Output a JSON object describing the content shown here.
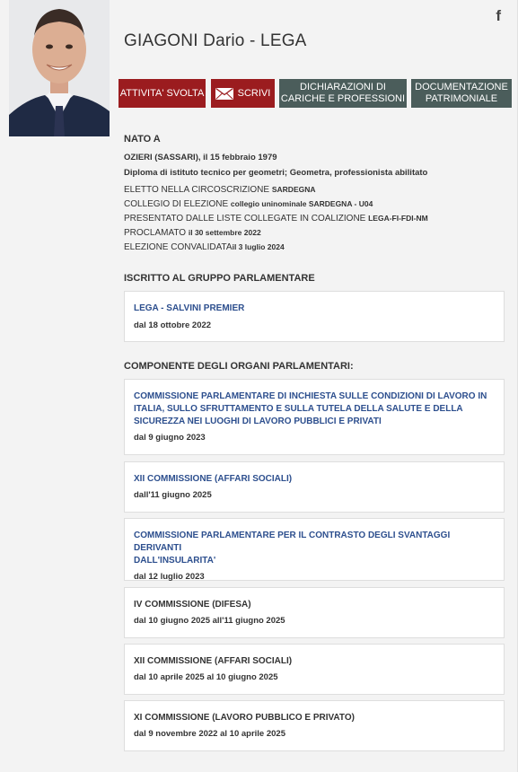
{
  "deputy": {
    "name": "GIAGONI Dario - LEGA",
    "facebook_label": "f"
  },
  "buttons": {
    "attivita": "ATTIVITA' SVOLTA",
    "scrivi": "SCRIVI",
    "dichiarazioni": [
      "DICHIARAZIONI DI",
      "CARICHE E PROFESSIONI"
    ],
    "documentazione": [
      "DOCUMENTAZIONE",
      "PATRIMONIALE"
    ]
  },
  "bio": {
    "heading": "NATO A",
    "birth": "OZIERI (SASSARI), il 15 febbraio 1979",
    "education": "Diploma di istituto tecnico per geometri; Geometra, professionista abilitato",
    "rows": [
      {
        "label": "ELETTO NELLA CIRCOSCRIZIONE ",
        "value": "SARDEGNA"
      },
      {
        "label": "COLLEGIO DI ELEZIONE ",
        "value": "collegio uninominale SARDEGNA - U04"
      },
      {
        "label": "PRESENTATO DALLE LISTE COLLEGATE IN COALIZIONE ",
        "value": "LEGA-FI-FDI-NM"
      },
      {
        "label": "PROCLAMATO ",
        "value": "il 30 settembre 2022"
      },
      {
        "label": "ELEZIONE CONVALIDATA",
        "value": "il 3 luglio 2024"
      }
    ]
  },
  "gruppo": {
    "heading": "ISCRITTO AL GRUPPO PARLAMENTARE",
    "name": "LEGA - SALVINI PREMIER",
    "date": "dal 18 ottobre 2022"
  },
  "organi": {
    "heading": "COMPONENTE DEGLI ORGANI PARLAMENTARI:",
    "items": [
      {
        "title": [
          "COMMISSIONE PARLAMENTARE DI INCHIESTA SULLE CONDIZIONI DI LAVORO IN",
          "ITALIA, SULLO SFRUTTAMENTO E SULLA TUTELA DELLA SALUTE E DELLA",
          "SICUREZZA NEI LUOGHI DI LAVORO PUBBLICI E PRIVATI"
        ],
        "date": "dal 9 giugno 2023"
      },
      {
        "title": [
          "XII COMMISSIONE (AFFARI SOCIALI)"
        ],
        "date": "dall'11 giugno 2025"
      },
      {
        "title": [
          "COMMISSIONE PARLAMENTARE PER IL CONTRASTO DEGLI SVANTAGGI DERIVANTI",
          "DALL'INSULARITA'"
        ],
        "date": "dal 12 luglio 2023"
      },
      {
        "title": [
          "IV COMMISSIONE (DIFESA)"
        ],
        "date": "dal 10 giugno 2025 all'11 giugno 2025"
      },
      {
        "title": [
          "XII COMMISSIONE (AFFARI SOCIALI)"
        ],
        "date": "dal 10 aprile 2025 al 10 giugno 2025"
      },
      {
        "title": [
          "XI COMMISSIONE (LAVORO PUBBLICO E PRIVATO)"
        ],
        "date": "dal 9 novembre 2022 al 10 aprile 2025"
      }
    ]
  },
  "colors": {
    "button_red": "#9b1c1f",
    "button_gray": "#4b5d5b",
    "link_blue": "#2d4f8e"
  }
}
